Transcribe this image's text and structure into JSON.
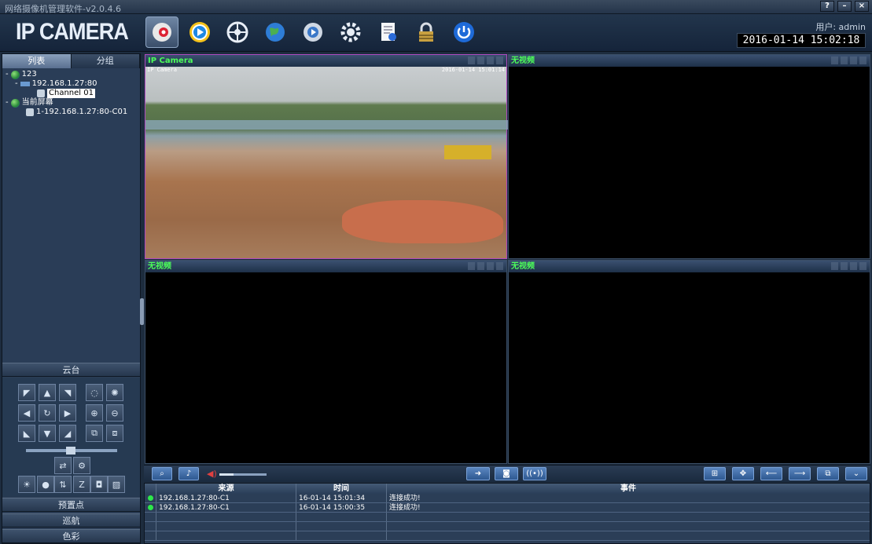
{
  "window": {
    "title": "网络摄像机管理软件",
    "version": "-v2.0.4.6",
    "buttons": [
      "?",
      "–",
      "×"
    ]
  },
  "header": {
    "logo": "IP CAMERA",
    "user_label": "用户: admin",
    "datetime": "2016-01-14  15:02:18"
  },
  "toolbar": {
    "items": [
      "preview-icon",
      "playback-icon",
      "remote-icon",
      "network-icon",
      "settings-icon",
      "gear-settings-icon",
      "log-icon",
      "lock-icon",
      "power-icon"
    ]
  },
  "sidebar": {
    "tabs": [
      "列表",
      "分组"
    ],
    "tree": [
      {
        "label": "123",
        "level": 0,
        "prefix": "-"
      },
      {
        "label": "192.168.1.27:80",
        "level": 1,
        "prefix": "-"
      },
      {
        "label": "Channel 01",
        "level": 2,
        "prefix": "",
        "selected": true
      },
      {
        "label": "当前屏幕",
        "level": 0,
        "prefix": "-"
      },
      {
        "label": "1-192.168.1.27:80-C01",
        "level": 1,
        "prefix": ""
      }
    ],
    "ptz_header": "云台",
    "sections": [
      "预置点",
      "巡航",
      "色彩"
    ]
  },
  "videos": [
    {
      "title": "IP Camera",
      "osd_left": "IP Camera",
      "osd_right": "2016-01-14 15:01:14",
      "active": true
    },
    {
      "title": "无视频"
    },
    {
      "title": "无视频"
    },
    {
      "title": "无视频"
    }
  ],
  "events": {
    "columns": [
      "来源",
      "时间",
      "事件"
    ],
    "rows": [
      {
        "source": "192.168.1.27:80-C1",
        "time": "16-01-14 15:01:34",
        "event": "连接成功!"
      },
      {
        "source": "192.168.1.27:80-C1",
        "time": "16-01-14 15:00:35",
        "event": "连接成功!"
      }
    ]
  },
  "colors": {
    "accent": "#4cff5a",
    "active_border": "#b04ac0"
  }
}
